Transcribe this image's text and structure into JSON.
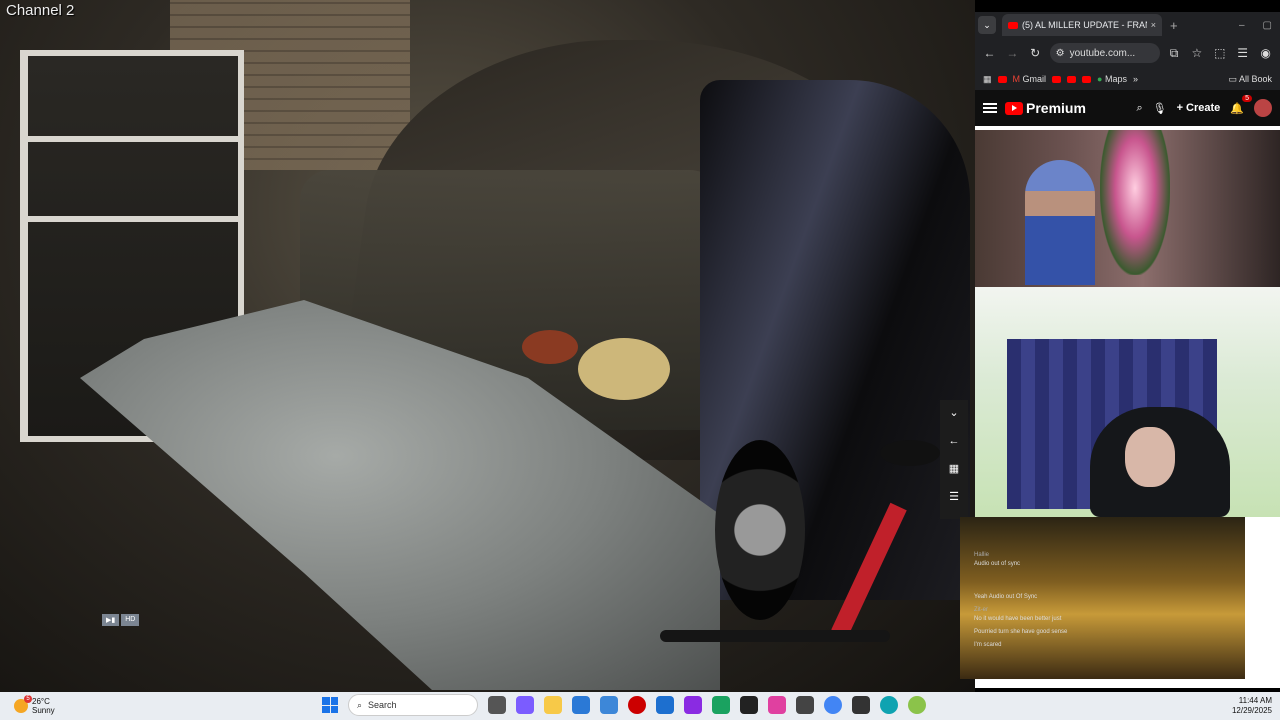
{
  "camera": {
    "channel_label": "Channel 2",
    "badge_left": "▶▮",
    "badge_right": "HD"
  },
  "browser": {
    "tab_title": "(5) AL MILLER UPDATE - FRAN",
    "tab_close": "×",
    "new_tab": "+",
    "url": "youtube.com...",
    "bookmarks": [
      "Gmail",
      "Maps"
    ],
    "all_bookmarks": "All Book",
    "window_min": "–",
    "window_max": "▢"
  },
  "youtube": {
    "logo": "Premium",
    "create_label": "Create",
    "notification_count": "5"
  },
  "chat": {
    "messages": [
      {
        "user": "Hallie",
        "text": "Audio out of sync"
      },
      {
        "user": "",
        "text": "Yeah Audio out Of Sync"
      },
      {
        "user": "Zit-er",
        "text": "No it would have been better just"
      },
      {
        "user": "",
        "text": "Pourried turn she have good sense"
      },
      {
        "user": "",
        "text": "I'm scared"
      }
    ]
  },
  "taskbar": {
    "weather_temp": "26°C",
    "weather_desc": "Sunny",
    "weather_badge": "5",
    "search_placeholder": "Search",
    "time": "11:44 AM",
    "date": "12/29/2025"
  },
  "colors": {
    "accent": "#1a73e8",
    "youtube_red": "#ff0000",
    "taskbar_bg": "#e9edf2"
  }
}
